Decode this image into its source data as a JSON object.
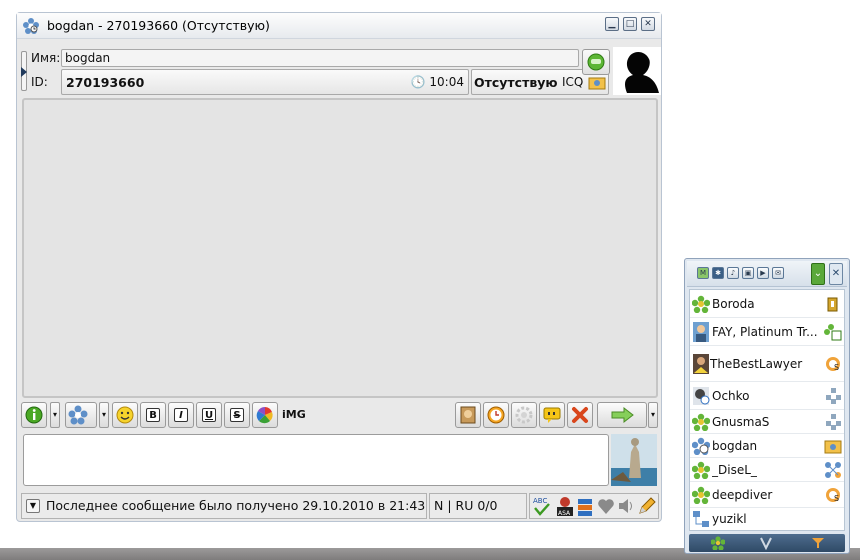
{
  "window": {
    "title": "bogdan - 270193660 (Отсутствую)",
    "buttons": [
      "minimize-button",
      "maximize-button",
      "close-button"
    ]
  },
  "contact_info": {
    "name_label": "Имя:",
    "name_value": "bogdan",
    "id_label": "ID:",
    "id_value": "270193660",
    "time": "10:04",
    "status": "Отсутствую",
    "protocol": "ICQ"
  },
  "toolbar": {
    "bold": "B",
    "italic": "I",
    "underline": "U",
    "strike": "S",
    "image": "iMG"
  },
  "statusbar": {
    "last_message": "Последнее сообщение было получено 29.10.2010 в 21:43",
    "typing": "N | RU 0/0"
  },
  "contact_list": {
    "contacts": [
      {
        "name": "Boroda"
      },
      {
        "name": "FAY, Platinum Tr..."
      },
      {
        "name": "TheBestLawyer"
      },
      {
        "name": "Ochko"
      },
      {
        "name": "GnusmaS"
      },
      {
        "name": "bogdan"
      },
      {
        "name": "_DiseL_"
      },
      {
        "name": "deepdiver"
      },
      {
        "name": "yuzikl"
      }
    ]
  },
  "colors": {
    "accent": "#4d9b2a",
    "titlebar": "#e7eaee",
    "history_bg": "#e4e4e4"
  }
}
